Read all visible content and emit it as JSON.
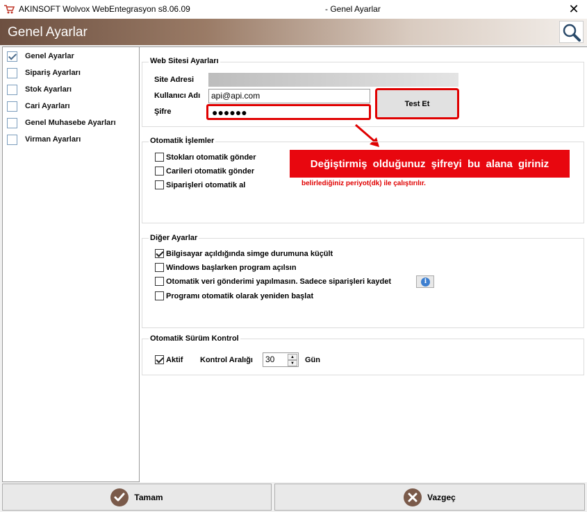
{
  "window": {
    "app_title": "AKINSOFT Wolvox WebEntegrasyon s8.06.09",
    "title": "- Genel Ayarlar",
    "close": "✕"
  },
  "header": {
    "title": "Genel Ayarlar"
  },
  "sidebar": {
    "items": [
      {
        "label": "Genel Ayarlar",
        "checked": true
      },
      {
        "label": "Sipariş Ayarları",
        "checked": false
      },
      {
        "label": "Stok Ayarları",
        "checked": false
      },
      {
        "label": "Cari Ayarları",
        "checked": false
      },
      {
        "label": "Genel Muhasebe Ayarları",
        "checked": false
      },
      {
        "label": "Virman Ayarları",
        "checked": false
      }
    ]
  },
  "web": {
    "group_title": "Web Sitesi Ayarları",
    "site_label": "Site Adresi",
    "user_label": "Kullanıcı Adı",
    "user_value": "api@api.com",
    "pass_label": "Şifre",
    "pass_value": "●●●●●●",
    "test_button": "Test Et"
  },
  "auto": {
    "group_title": "Otomatik İşlemler",
    "items": [
      {
        "label": "Stokları otomatik gönder",
        "checked": false
      },
      {
        "label": "Carileri otomatik gönder",
        "checked": false
      },
      {
        "label": "Siparişleri otomatik al",
        "checked": false
      }
    ],
    "note": "belirlediğiniz periyot(dk) ile çalıştırılır."
  },
  "callout": {
    "text": "Değiştirmiş olduğunuz şifreyi bu alana giriniz"
  },
  "other": {
    "group_title": "Diğer Ayarlar",
    "items": [
      {
        "label": "Bilgisayar açıldığında simge durumuna küçült",
        "checked": true
      },
      {
        "label": "Windows başlarken program açılsın",
        "checked": false
      },
      {
        "label": "Otomatik veri gönderimi yapılmasın. Sadece siparişleri kaydet",
        "checked": false
      },
      {
        "label": "Programı otomatik olarak yeniden başlat",
        "checked": false
      }
    ],
    "info_icon": "i"
  },
  "version": {
    "group_title": "Otomatik Sürüm Kontrol",
    "active_label": "Aktif",
    "active_checked": true,
    "interval_label": "Kontrol Aralığı",
    "interval_value": "30",
    "unit": "Gün",
    "spin_up": "▲",
    "spin_down": "▼"
  },
  "footer": {
    "ok_label": "Tamam",
    "cancel_label": "Vazgeç"
  },
  "colors": {
    "accent_red": "#e00000",
    "header_brown": "#6d5041"
  }
}
